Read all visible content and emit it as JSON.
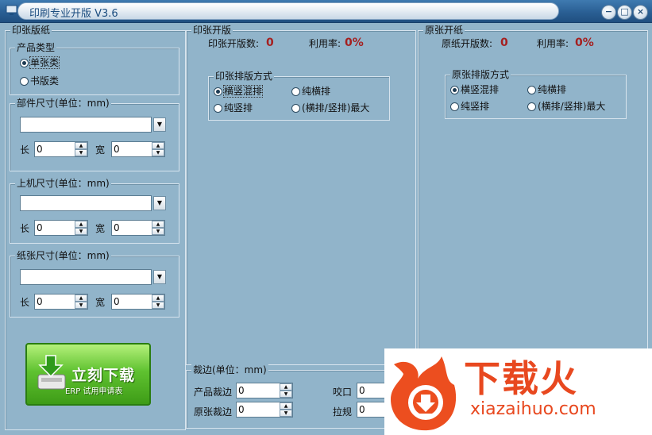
{
  "window": {
    "title": "印刷专业开版 V3.6",
    "btn_min": "−",
    "btn_max": "□",
    "btn_close": "×"
  },
  "left": {
    "group_title": "印张版纸",
    "product_type": {
      "title": "产品类型",
      "options": [
        {
          "label": "单张类",
          "checked": true
        },
        {
          "label": "书版类",
          "checked": false
        }
      ]
    },
    "part_size": {
      "title": "部件尺寸(单位：mm)",
      "combo_value": "",
      "len_label": "长",
      "len_value": "0",
      "wid_label": "宽",
      "wid_value": "0"
    },
    "press_size": {
      "title": "上机尺寸(单位：mm)",
      "combo_value": "",
      "len_label": "长",
      "len_value": "0",
      "wid_label": "宽",
      "wid_value": "0"
    },
    "paper_size": {
      "title": "纸张尺寸(单位：mm)",
      "combo_value": "",
      "len_label": "长",
      "len_value": "0",
      "wid_label": "宽",
      "wid_value": "0"
    }
  },
  "download": {
    "main": "立刻下载",
    "sub": "ERP 试用申请表"
  },
  "print_sheet": {
    "group_title": "印张开版",
    "count_label": "印张开版数:",
    "count_value": "0",
    "util_label": "利用率:",
    "util_value": "0%",
    "layout": {
      "title": "印张排版方式",
      "options": [
        {
          "label": "横竖混排",
          "checked": true
        },
        {
          "label": "纯横排",
          "checked": false
        },
        {
          "label": "纯竖排",
          "checked": false
        },
        {
          "label": "(横排/竖排)最大",
          "checked": false
        }
      ]
    }
  },
  "raw_sheet": {
    "group_title": "原张开纸",
    "count_label": "原纸开版数:",
    "count_value": "0",
    "util_label": "利用率:",
    "util_value": "0%",
    "layout": {
      "title": "原张排版方式",
      "options": [
        {
          "label": "横竖混排",
          "checked": true
        },
        {
          "label": "纯横排",
          "checked": false
        },
        {
          "label": "纯竖排",
          "checked": false
        },
        {
          "label": "(横排/竖排)最大",
          "checked": false
        }
      ]
    }
  },
  "trim": {
    "group_title": "裁边(单位：mm)",
    "product_trim_label": "产品裁边",
    "product_trim_value": "0",
    "raw_trim_label": "原张裁边",
    "raw_trim_value": "0",
    "bite_label": "咬口",
    "bite_value": "0",
    "pull_label": "拉规",
    "pull_value": "0"
  },
  "watermark": {
    "cn": "下载火",
    "en": "xiazaihuo.com",
    "color": "#e8481f"
  }
}
